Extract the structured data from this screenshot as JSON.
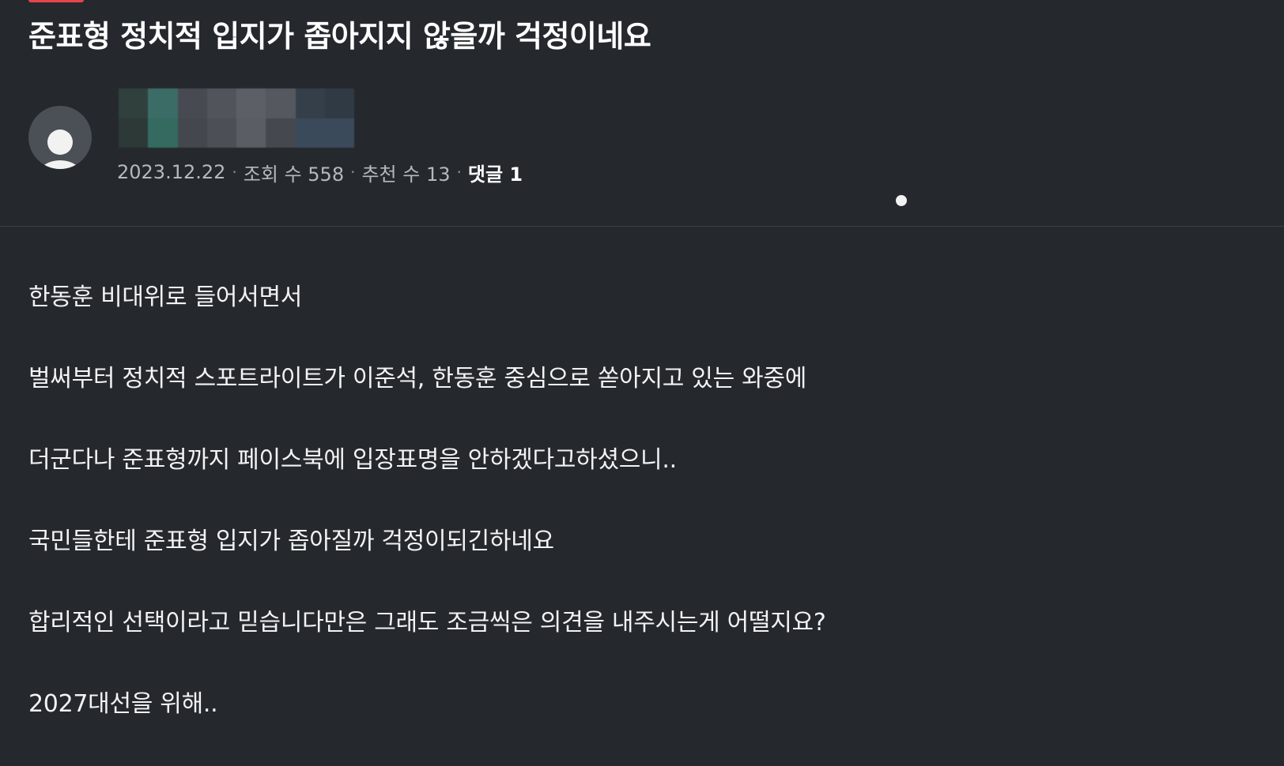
{
  "post": {
    "title": "준표형 정치적 입지가 좁아지지 않을까 걱정이네요",
    "author": {
      "name_redacted": "pixelated author name",
      "avatar_icon": "default-user-icon",
      "blur_colors": [
        "#2f403d",
        "#3c6c66",
        "#474b51",
        "#51555b",
        "#5c6066",
        "#55595f",
        "#353f4a",
        "#303a45",
        "#2c3937",
        "#356a61",
        "#44484e",
        "#4c5056",
        "#5a5e64",
        "#45494f",
        "#3b4a5a",
        "#3a4a5b"
      ]
    },
    "meta": {
      "date": "2023.12.22",
      "separator": "·",
      "views": "조회 수 558",
      "recommendations": "추천 수 13",
      "comments": "댓글 1"
    },
    "body_paragraphs": [
      "한동훈 비대위로 들어서면서",
      "벌써부터 정치적 스포트라이트가 이준석, 한동훈 중심으로 쏟아지고 있는 와중에",
      "더군다나 준표형까지 페이스북에 입장표명을 안하겠다고하셨으니..",
      "국민들한테 준표형 입지가 좁아질까 걱정이되긴하네요",
      "합리적인 선택이라고 믿습니다만은 그래도 조금씩은 의견을 내주시는게 어떨지요?",
      "2027대선을 위해.."
    ]
  },
  "colors": {
    "background": "#25292e",
    "text_primary": "#ffffff",
    "text_meta": "#b5b9bf",
    "accent": "#e8454a",
    "divider": "#3b4047"
  }
}
